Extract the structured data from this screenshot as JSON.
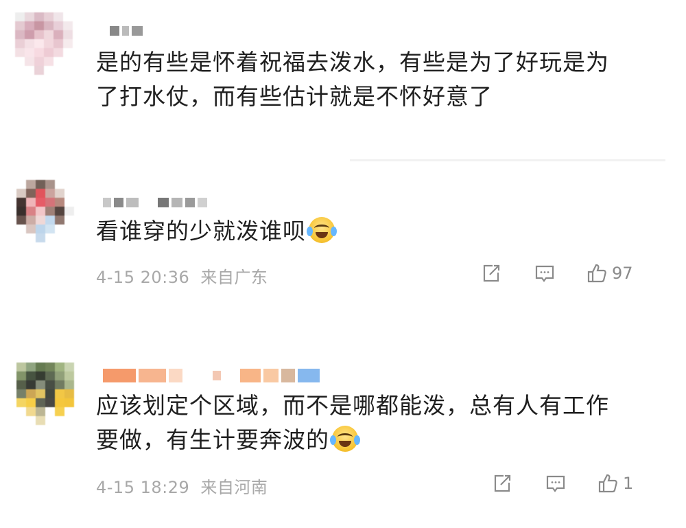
{
  "comments": [
    {
      "text_lines": [
        "是的有些是怀着祝福去泼水，有些是为了好玩是为",
        "了打水仗，而有些估计就是不怀好意了"
      ]
    },
    {
      "text": "看谁穿的少就泼谁呗",
      "emoji": "laughing-crying-emoji",
      "time": "4-15 20:36",
      "location": "来自广东",
      "likes": "97"
    },
    {
      "text_lines": [
        "应该划定个区域，而不是哪都能泼，总有人有工作",
        "要做，有生计要奔波的"
      ],
      "emoji": "laughing-crying-emoji",
      "time": "4-15 18:29",
      "location": "来自河南",
      "likes": "1"
    }
  ],
  "icons": {
    "share": "share-icon",
    "comment": "comment-icon",
    "like": "thumbs-up-icon"
  },
  "colors": {
    "text": "#1f1f1f",
    "meta": "#a8a8a8",
    "icon": "#8a8a8a"
  }
}
